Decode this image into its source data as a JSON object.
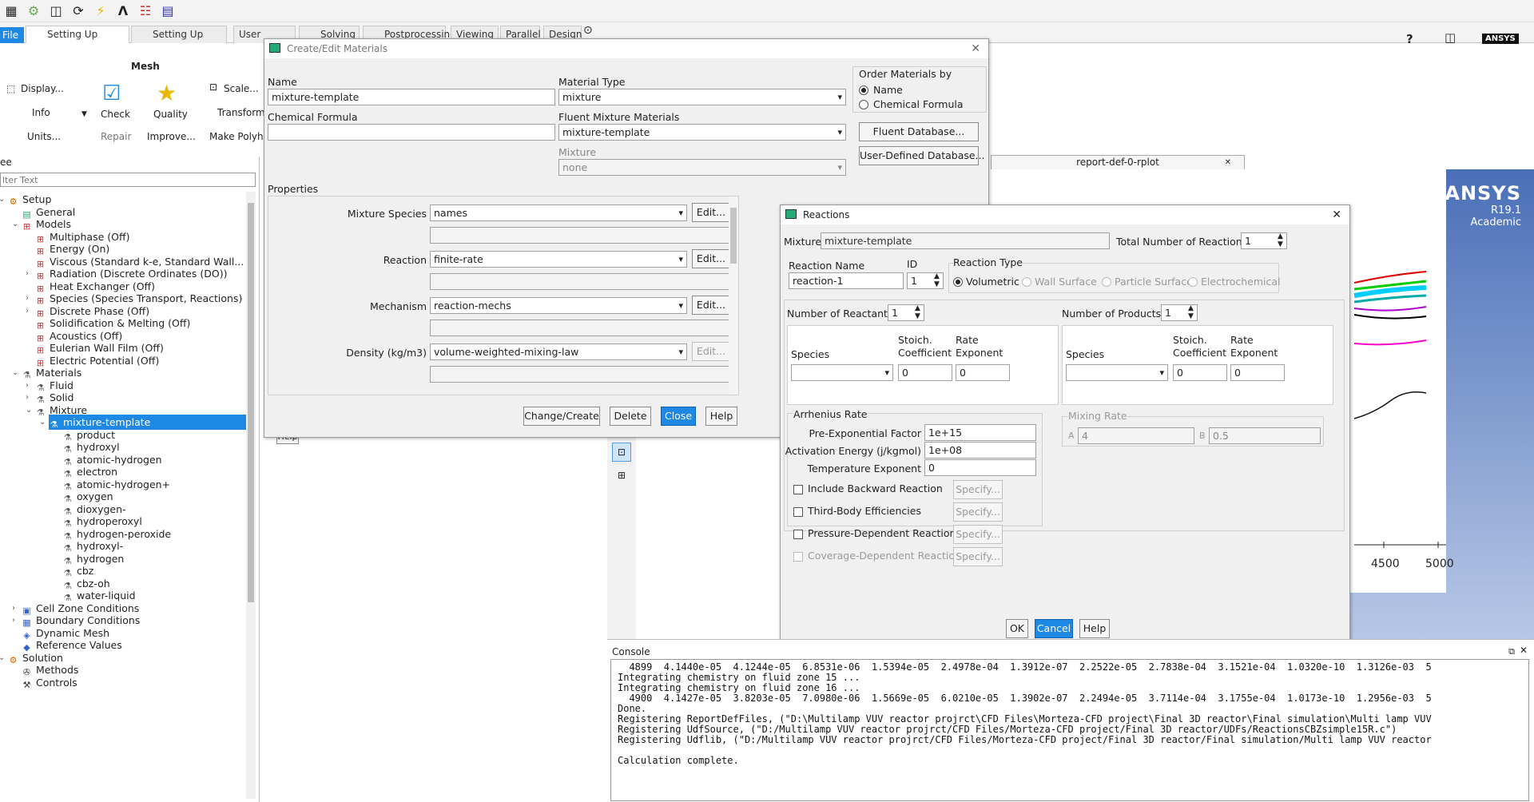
{
  "ribbon_tabs": {
    "file": "File",
    "tabs": [
      "Setting Up Domain",
      "Setting Up Physics",
      "User Defined",
      "Solving",
      "Postprocessing",
      "Viewing",
      "Parallel",
      "Design"
    ]
  },
  "ribbon": {
    "group_title": "Mesh",
    "display": "Display...",
    "info": "Info",
    "units": "Units...",
    "check": "Check",
    "repair": "Repair",
    "quality": "Quality",
    "improve": "Improve...",
    "scale": "Scale...",
    "transform": "Transform",
    "make_polyhedra": "Make Polyh"
  },
  "logo": {
    "ansys_small": "ANSYS",
    "brand": "ANSYS",
    "version": "R19.1",
    "edition": "Academic"
  },
  "tree": {
    "header": "ee",
    "filter_placeholder": "lter Text",
    "items": [
      "Setup",
      "General",
      "Models",
      "Multiphase (Off)",
      "Energy (On)",
      "Viscous (Standard k-e, Standard Wall...",
      "Radiation (Discrete Ordinates (DO))",
      "Heat Exchanger (Off)",
      "Species (Species Transport, Reactions)",
      "Discrete Phase (Off)",
      "Solidification & Melting (Off)",
      "Acoustics (Off)",
      "Eulerian Wall Film (Off)",
      "Electric Potential (Off)",
      "Materials",
      "Fluid",
      "Solid",
      "Mixture",
      "mixture-template",
      "product",
      "hydroxyl",
      "atomic-hydrogen",
      "electron",
      "atomic-hydrogen+",
      "oxygen",
      "dioxygen-",
      "hydroperoxyl",
      "hydrogen-peroxide",
      "hydroxyl-",
      "hydrogen",
      "cbz",
      "cbz-oh",
      "water-liquid",
      "Cell Zone Conditions",
      "Boundary Conditions",
      "Dynamic Mesh",
      "Reference Values",
      "Solution",
      "Methods",
      "Controls"
    ]
  },
  "plot_tab": "report-def-0-rplot",
  "plot_axis": {
    "t1": "4500",
    "t2": "5000"
  },
  "materials_dialog": {
    "title": "Create/Edit Materials",
    "name_label": "Name",
    "name_value": "mixture-template",
    "formula_label": "Chemical Formula",
    "formula_value": "",
    "type_label": "Material Type",
    "type_value": "mixture",
    "fluent_mix_label": "Fluent Mixture Materials",
    "fluent_mix_value": "mixture-template",
    "mixture_label": "Mixture",
    "mixture_value": "none",
    "order_label": "Order Materials by",
    "order_name": "Name",
    "order_formula": "Chemical Formula",
    "fluent_db": "Fluent Database...",
    "user_db": "User-Defined Database...",
    "properties_label": "Properties",
    "props": [
      {
        "label": "Mixture Species",
        "value": "names",
        "btn": "Edit..."
      },
      {
        "label": "Reaction",
        "value": "finite-rate",
        "btn": "Edit..."
      },
      {
        "label": "Mechanism",
        "value": "reaction-mechs",
        "btn": "Edit..."
      },
      {
        "label": "Density (kg/m3)",
        "value": "volume-weighted-mixing-law",
        "btn": "Edit..."
      }
    ],
    "change_create": "Change/Create",
    "delete": "Delete",
    "close": "Close",
    "help": "Help",
    "help_behind": "Help"
  },
  "reactions_dialog": {
    "title": "Reactions",
    "mixture_label": "Mixture",
    "mixture_value": "mixture-template",
    "total_label": "Total Number of Reactions",
    "total_value": "1",
    "rname_label": "Reaction Name",
    "rname_value": "reaction-1",
    "id_label": "ID",
    "id_value": "1",
    "rtype_label": "Reaction Type",
    "rtypes": [
      "Volumetric",
      "Wall Surface",
      "Particle Surface",
      "Electrochemical"
    ],
    "reactants_label": "Number of Reactants",
    "reactants_value": "1",
    "products_label": "Number of Products",
    "products_value": "1",
    "species_label": "Species",
    "stoich_label": "Stoich.",
    "coef_label": "Coefficient",
    "rate_label": "Rate",
    "exp_label": "Exponent",
    "r_stoich": "0",
    "r_rate": "0",
    "p_stoich": "0",
    "p_rate": "0",
    "arrhenius_label": "Arrhenius Rate",
    "pef_label": "Pre-Exponential Factor",
    "pef_value": "1e+15",
    "ae_label": "Activation Energy (j/kgmol)",
    "ae_value": "1e+08",
    "te_label": "Temperature Exponent",
    "te_value": "0",
    "options": [
      "Include Backward Reaction",
      "Third-Body Efficiencies",
      "Pressure-Dependent Reaction",
      "Coverage-Dependent Reaction"
    ],
    "specify": "Specify...",
    "mixing_label": "Mixing Rate",
    "a_label": "A",
    "a_value": "4",
    "b_label": "B",
    "b_value": "0.5",
    "ok": "OK",
    "cancel": "Cancel",
    "help": "Help"
  },
  "console": {
    "title": "Console",
    "lines": [
      "  4899  4.1440e-05  4.1244e-05  6.8531e-06  1.5394e-05  2.4978e-04  1.3912e-07  2.2522e-05  2.7838e-04  3.1521e-04  1.0320e-10  1.3126e-03  5",
      "Integrating chemistry on fluid zone 15 ...",
      "Integrating chemistry on fluid zone 16 ...",
      "  4900  4.1427e-05  3.8203e-05  7.0980e-06  1.5669e-05  6.0210e-05  1.3902e-07  2.2494e-05  3.7114e-04  3.1755e-04  1.0173e-10  1.2956e-03  5",
      "Done.",
      "Registering ReportDefFiles, (\"D:\\Multilamp VUV reactor projrct\\CFD Files\\Morteza-CFD project\\Final 3D reactor\\Final simulation\\Multi lamp VUV",
      "Registering UdfSource, (\"D:/Multilamp VUV reactor projrct/CFD Files/Morteza-CFD project/Final 3D reactor/UDFs/ReactionsCBZsimple15R.c\")",
      "Registering Udflib, (\"D:/Multilamp VUV reactor projrct/CFD Files/Morteza-CFD project/Final 3D reactor/Final simulation/Multi lamp VUV reactor",
      "",
      "Calculation complete."
    ]
  }
}
